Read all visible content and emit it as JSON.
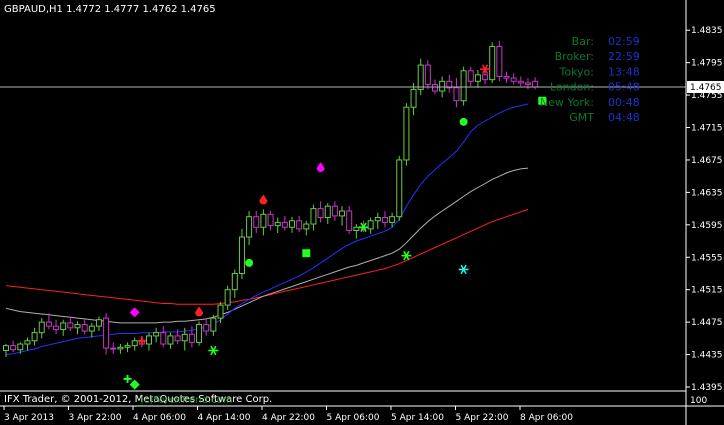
{
  "header": {
    "symbol_text": "GBPAUD,H1  1.4772 1.4777 1.4762 1.4765"
  },
  "price_axis": {
    "ticks": [
      "1.4835",
      "1.4795",
      "1.4755",
      "1.4715",
      "1.4675",
      "1.4635",
      "1.4595",
      "1.4555",
      "1.4515",
      "1.4475",
      "1.4435",
      "1.4395"
    ],
    "current_price_label": "1.4765",
    "indicator_value_label": "100"
  },
  "time_axis": {
    "ticks": [
      "3 Apr 2013",
      "3 Apr 22:00",
      "4 Apr 06:00",
      "4 Apr 14:00",
      "4 Apr 22:00",
      "5 Apr 06:00",
      "5 Apr 14:00",
      "5 Apr 22:00",
      "8 Apr 06:00"
    ]
  },
  "info_panel": {
    "items": [
      {
        "label": "Bar:",
        "value": "02:59"
      },
      {
        "label": "Broker:",
        "value": "22:59"
      },
      {
        "label": "Tokyo:",
        "value": "13:48"
      },
      {
        "label": "London:",
        "value": "05:48"
      },
      {
        "label": "New York:",
        "value": "00:48"
      },
      {
        "label": "GMT",
        "value": "04:48"
      }
    ]
  },
  "footer": {
    "copyright_text": "IFX Trader, © 2001-2012, MetaQuotes Software Corp.",
    "overlay_text": "(c)ForexTrend.com"
  },
  "colors": {
    "background": "#000000",
    "axis_text": "#ffffff",
    "bull_candle": "#66cc44",
    "bear_candle": "#cc33cc",
    "ma_fast": "#2233ff",
    "ma_mid": "#b0b0b0",
    "ma_slow": "#ff2020",
    "info_label": "#0a7a2a",
    "info_value": "#1a33cc"
  },
  "chart_data": {
    "type": "candlestick",
    "symbol": "GBPAUD",
    "timeframe": "H1",
    "ylim": [
      1.4395,
      1.4855
    ],
    "current_price": 1.4765,
    "candles": [
      [
        1.444,
        1.4448,
        1.4432,
        1.4446
      ],
      [
        1.4446,
        1.4452,
        1.4438,
        1.4441
      ],
      [
        1.4441,
        1.445,
        1.4436,
        1.4448
      ],
      [
        1.4448,
        1.4456,
        1.444,
        1.4452
      ],
      [
        1.4452,
        1.4468,
        1.4446,
        1.4462
      ],
      [
        1.4462,
        1.448,
        1.4455,
        1.4475
      ],
      [
        1.4475,
        1.4486,
        1.4466,
        1.447
      ],
      [
        1.447,
        1.4478,
        1.446,
        1.4466
      ],
      [
        1.4466,
        1.4478,
        1.4458,
        1.4474
      ],
      [
        1.4474,
        1.4482,
        1.4464,
        1.4468
      ],
      [
        1.4468,
        1.4476,
        1.446,
        1.4472
      ],
      [
        1.4472,
        1.448,
        1.446,
        1.4464
      ],
      [
        1.4464,
        1.4474,
        1.4456,
        1.447
      ],
      [
        1.447,
        1.4482,
        1.4464,
        1.4478
      ],
      [
        1.448,
        1.4486,
        1.4435,
        1.4443
      ],
      [
        1.4443,
        1.445,
        1.4436,
        1.4442
      ],
      [
        1.4442,
        1.4448,
        1.4436,
        1.4444
      ],
      [
        1.4444,
        1.445,
        1.4438,
        1.4446
      ],
      [
        1.4446,
        1.4456,
        1.444,
        1.4452
      ],
      [
        1.4452,
        1.4458,
        1.4444,
        1.4448
      ],
      [
        1.4448,
        1.4462,
        1.444,
        1.4458
      ],
      [
        1.4458,
        1.4468,
        1.445,
        1.4462
      ],
      [
        1.4462,
        1.447,
        1.4444,
        1.4448
      ],
      [
        1.4448,
        1.4462,
        1.4442,
        1.4458
      ],
      [
        1.4458,
        1.4466,
        1.4448,
        1.4452
      ],
      [
        1.4452,
        1.4468,
        1.444,
        1.446
      ],
      [
        1.446,
        1.447,
        1.4444,
        1.445
      ],
      [
        1.445,
        1.4476,
        1.4446,
        1.4472
      ],
      [
        1.4472,
        1.448,
        1.4458,
        1.4464
      ],
      [
        1.4464,
        1.4484,
        1.4458,
        1.448
      ],
      [
        1.448,
        1.45,
        1.4474,
        1.4496
      ],
      [
        1.4496,
        1.452,
        1.449,
        1.4515
      ],
      [
        1.4515,
        1.454,
        1.4505,
        1.4535
      ],
      [
        1.4535,
        1.459,
        1.4528,
        1.458
      ],
      [
        1.458,
        1.4612,
        1.457,
        1.4605
      ],
      [
        1.4605,
        1.4612,
        1.4585,
        1.4592
      ],
      [
        1.4592,
        1.4614,
        1.4582,
        1.4608
      ],
      [
        1.4608,
        1.4612,
        1.4588,
        1.4594
      ],
      [
        1.4594,
        1.4604,
        1.4585,
        1.4598
      ],
      [
        1.4598,
        1.4606,
        1.4588,
        1.4592
      ],
      [
        1.4592,
        1.4605,
        1.4585,
        1.46
      ],
      [
        1.46,
        1.4606,
        1.4586,
        1.459
      ],
      [
        1.459,
        1.46,
        1.4582,
        1.4596
      ],
      [
        1.4596,
        1.462,
        1.4588,
        1.4615
      ],
      [
        1.4615,
        1.4624,
        1.4598,
        1.4604
      ],
      [
        1.4604,
        1.4622,
        1.4596,
        1.4618
      ],
      [
        1.4618,
        1.4624,
        1.46,
        1.4606
      ],
      [
        1.4606,
        1.4618,
        1.4594,
        1.4612
      ],
      [
        1.4612,
        1.4618,
        1.4584,
        1.4588
      ],
      [
        1.4588,
        1.4596,
        1.4578,
        1.4592
      ],
      [
        1.4592,
        1.46,
        1.4586,
        1.459
      ],
      [
        1.459,
        1.4604,
        1.4584,
        1.46
      ],
      [
        1.46,
        1.461,
        1.459,
        1.4604
      ],
      [
        1.4604,
        1.4612,
        1.4592,
        1.4598
      ],
      [
        1.4598,
        1.461,
        1.4592,
        1.4605
      ],
      [
        1.4605,
        1.468,
        1.46,
        1.4675
      ],
      [
        1.4675,
        1.4745,
        1.4668,
        1.474
      ],
      [
        1.474,
        1.477,
        1.473,
        1.4762
      ],
      [
        1.4762,
        1.48,
        1.4755,
        1.4792
      ],
      [
        1.4792,
        1.4798,
        1.4762,
        1.4768
      ],
      [
        1.4768,
        1.4774,
        1.4756,
        1.476
      ],
      [
        1.476,
        1.4778,
        1.4752,
        1.4772
      ],
      [
        1.4772,
        1.478,
        1.4758,
        1.4764
      ],
      [
        1.4764,
        1.4776,
        1.474,
        1.4748
      ],
      [
        1.4748,
        1.479,
        1.4742,
        1.4785
      ],
      [
        1.4785,
        1.479,
        1.4766,
        1.4772
      ],
      [
        1.4772,
        1.4786,
        1.4764,
        1.478
      ],
      [
        1.478,
        1.4786,
        1.4768,
        1.4774
      ],
      [
        1.4774,
        1.482,
        1.477,
        1.4815
      ],
      [
        1.4815,
        1.4822,
        1.4772,
        1.4778
      ],
      [
        1.4778,
        1.4784,
        1.477,
        1.4776
      ],
      [
        1.4776,
        1.4782,
        1.4768,
        1.4772
      ],
      [
        1.4772,
        1.4778,
        1.4766,
        1.477
      ],
      [
        1.477,
        1.4776,
        1.4762,
        1.4768
      ],
      [
        1.4772,
        1.4777,
        1.4762,
        1.4765
      ]
    ],
    "ma_fast": [
      1.4435,
      1.4436,
      1.4438,
      1.444,
      1.4442,
      1.4445,
      1.4447,
      1.4449,
      1.4451,
      1.4453,
      1.4455,
      1.4456,
      1.4457,
      1.4458,
      1.4459,
      1.446,
      1.4461,
      1.4461,
      1.4461,
      1.4462,
      1.4462,
      1.4462,
      1.4463,
      1.4463,
      1.4463,
      1.4464,
      1.4465,
      1.4467,
      1.4469,
      1.4472,
      1.4478,
      1.4485,
      1.4492,
      1.4498,
      1.4503,
      1.4508,
      1.4512,
      1.4516,
      1.452,
      1.4524,
      1.4528,
      1.4532,
      1.4537,
      1.4542,
      1.4548,
      1.4554,
      1.456,
      1.4566,
      1.4571,
      1.4575,
      1.4578,
      1.4581,
      1.4584,
      1.4587,
      1.4592,
      1.4602,
      1.4618,
      1.4632,
      1.4645,
      1.4655,
      1.4663,
      1.4671,
      1.4678,
      1.4686,
      1.4697,
      1.471,
      1.4718,
      1.4723,
      1.4728,
      1.4733,
      1.4737,
      1.474,
      1.4742,
      1.4744
    ],
    "ma_mid": [
      1.4492,
      1.449,
      1.4488,
      1.4487,
      1.4486,
      1.4485,
      1.4484,
      1.4483,
      1.4482,
      1.4481,
      1.448,
      1.4479,
      1.4478,
      1.4477,
      1.4476,
      1.4475,
      1.4474,
      1.4474,
      1.4474,
      1.4474,
      1.4474,
      1.4474,
      1.4475,
      1.4475,
      1.4476,
      1.4476,
      1.4477,
      1.4478,
      1.4479,
      1.4481,
      1.4484,
      1.4487,
      1.4491,
      1.4495,
      1.4499,
      1.4503,
      1.4507,
      1.451,
      1.4513,
      1.4516,
      1.4519,
      1.4522,
      1.4525,
      1.4528,
      1.4531,
      1.4534,
      1.4537,
      1.454,
      1.4543,
      1.4545,
      1.4548,
      1.4551,
      1.4554,
      1.4557,
      1.456,
      1.4565,
      1.4573,
      1.4582,
      1.4591,
      1.4599,
      1.4606,
      1.4612,
      1.4618,
      1.4624,
      1.463,
      1.4636,
      1.4641,
      1.4646,
      1.4651,
      1.4655,
      1.4659,
      1.4662,
      1.4664,
      1.4665
    ],
    "ma_slow": [
      1.452,
      1.4519,
      1.4518,
      1.4517,
      1.4516,
      1.4515,
      1.4514,
      1.4513,
      1.4512,
      1.4511,
      1.451,
      1.4509,
      1.4508,
      1.4507,
      1.4506,
      1.4505,
      1.4504,
      1.4503,
      1.4502,
      1.4501,
      1.45,
      1.4499,
      1.4498,
      1.4498,
      1.4497,
      1.4497,
      1.4497,
      1.4497,
      1.4497,
      1.4497,
      1.4498,
      1.4499,
      1.45,
      1.4502,
      1.4503,
      1.4505,
      1.4507,
      1.4509,
      1.4511,
      1.4513,
      1.4515,
      1.4517,
      1.4519,
      1.4521,
      1.4523,
      1.4525,
      1.4527,
      1.4529,
      1.4531,
      1.4533,
      1.4535,
      1.4537,
      1.4539,
      1.4541,
      1.4544,
      1.4547,
      1.4551,
      1.4555,
      1.4559,
      1.4563,
      1.4567,
      1.4571,
      1.4575,
      1.4579,
      1.4583,
      1.4587,
      1.4591,
      1.4595,
      1.4599,
      1.4602,
      1.4605,
      1.4608,
      1.4611,
      1.4614
    ],
    "signals": [
      {
        "shape": "plus",
        "color": "#ff2020",
        "index": 19,
        "price": 1.4452
      },
      {
        "shape": "diamond",
        "color": "#ff00ff",
        "index": 18,
        "price": 1.4487
      },
      {
        "shape": "plus",
        "color": "#22ff22",
        "index": 17,
        "price": 1.4405
      },
      {
        "shape": "diamond",
        "color": "#22ff22",
        "index": 18,
        "price": 1.4398
      },
      {
        "shape": "asterisk",
        "color": "#22ff22",
        "index": 29,
        "price": 1.444
      },
      {
        "shape": "drop",
        "color": "#ff2020",
        "index": 27,
        "price": 1.4487
      },
      {
        "shape": "circle",
        "color": "#22ff22",
        "index": 34,
        "price": 1.4548
      },
      {
        "shape": "drop",
        "color": "#ff2020",
        "index": 36,
        "price": 1.4625
      },
      {
        "shape": "square",
        "color": "#22ff22",
        "index": 42,
        "price": 1.456
      },
      {
        "shape": "drop",
        "color": "#ff00ff",
        "index": 44,
        "price": 1.4665
      },
      {
        "shape": "asterisk",
        "color": "#22ff22",
        "index": 50,
        "price": 1.4592
      },
      {
        "shape": "asterisk",
        "color": "#22ff22",
        "index": 56,
        "price": 1.4557
      },
      {
        "shape": "asterisk",
        "color": "#22eeee",
        "index": 64,
        "price": 1.454
      },
      {
        "shape": "circle",
        "color": "#22ff22",
        "index": 64,
        "price": 1.4722
      },
      {
        "shape": "asterisk",
        "color": "#ff2020",
        "index": 67,
        "price": 1.4787
      },
      {
        "shape": "square",
        "color": "#22ff22",
        "index": 75,
        "price": 1.4748
      }
    ]
  }
}
